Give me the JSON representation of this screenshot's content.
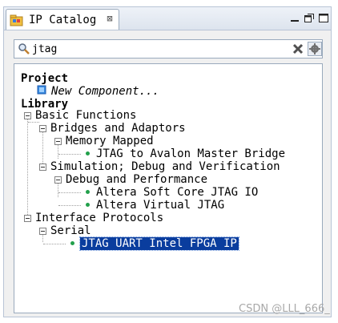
{
  "panel": {
    "tab_title": "IP Catalog",
    "close_glyph": "⊠"
  },
  "search": {
    "value": "jtag",
    "placeholder": ""
  },
  "tree": {
    "project_label": "Project",
    "new_component_label": "New Component...",
    "library_label": "Library",
    "basic_functions": "Basic Functions",
    "bridges_adaptors": "Bridges and Adaptors",
    "memory_mapped": "Memory Mapped",
    "jtag_avalon_bridge": "JTAG to Avalon Master Bridge",
    "simulation_debug": "Simulation; Debug and Verification",
    "debug_performance": "Debug and Performance",
    "altera_soft_core_jtag": "Altera Soft Core JTAG IO",
    "altera_virtual_jtag": "Altera Virtual JTAG",
    "interface_protocols": "Interface Protocols",
    "serial": "Serial",
    "jtag_uart": "JTAG UART Intel FPGA IP"
  },
  "watermark": "CSDN @LLL_666_",
  "colors": {
    "selection": "#0a3d9e",
    "leaf_dot": "#22a04b"
  }
}
